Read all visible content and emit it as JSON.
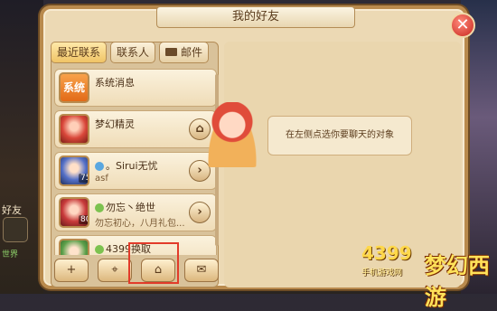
{
  "dialog": {
    "title": "我的好友",
    "close_label": "✕",
    "tabs": [
      {
        "label": "最近联系",
        "active": true
      },
      {
        "label": "联系人",
        "active": false
      },
      {
        "label": "邮件",
        "active": false
      }
    ]
  },
  "friends": [
    {
      "name": "系统消息",
      "sub": "",
      "avatar": "system-avatar",
      "avatar_text": "系统",
      "level": "",
      "action": ""
    },
    {
      "name": "梦幻精灵",
      "sub": "",
      "avatar": "sprite-avatar",
      "avatar_text": "",
      "level": "",
      "action": "home-icon"
    },
    {
      "name": "。Sirui无忧",
      "sub": "asf",
      "avatar": "player-avatar",
      "avatar_text": "",
      "level": "75",
      "action": "chevron-right-icon"
    },
    {
      "name": "勿忘丶绝世",
      "sub": "勿忘初心，八月礼包...",
      "avatar": "player-avatar",
      "avatar_text": "",
      "level": "80",
      "action": "chevron-right-icon"
    },
    {
      "name": "4399换取",
      "sub": "",
      "avatar": "player-avatar",
      "avatar_text": "",
      "level": "",
      "action": ""
    }
  ],
  "toolbar": {
    "buttons": [
      {
        "icon": "add-friend-icon",
        "glyph": "+"
      },
      {
        "icon": "location-icon",
        "glyph": "⌖"
      },
      {
        "icon": "home-icon",
        "glyph": "⌂"
      },
      {
        "icon": "chat-icon",
        "glyph": "✉"
      }
    ]
  },
  "chat": {
    "prompt": "在左侧点选你要聊天的对象"
  },
  "side": {
    "friends_label": "好友",
    "world_label": "世界"
  },
  "watermark": {
    "brand": "4399",
    "site": "手机游戏网",
    "game": "梦幻西游"
  },
  "colors": {
    "panel": "#ecd9b4",
    "border": "#b98a4d",
    "highlight": "#e23b2a"
  }
}
